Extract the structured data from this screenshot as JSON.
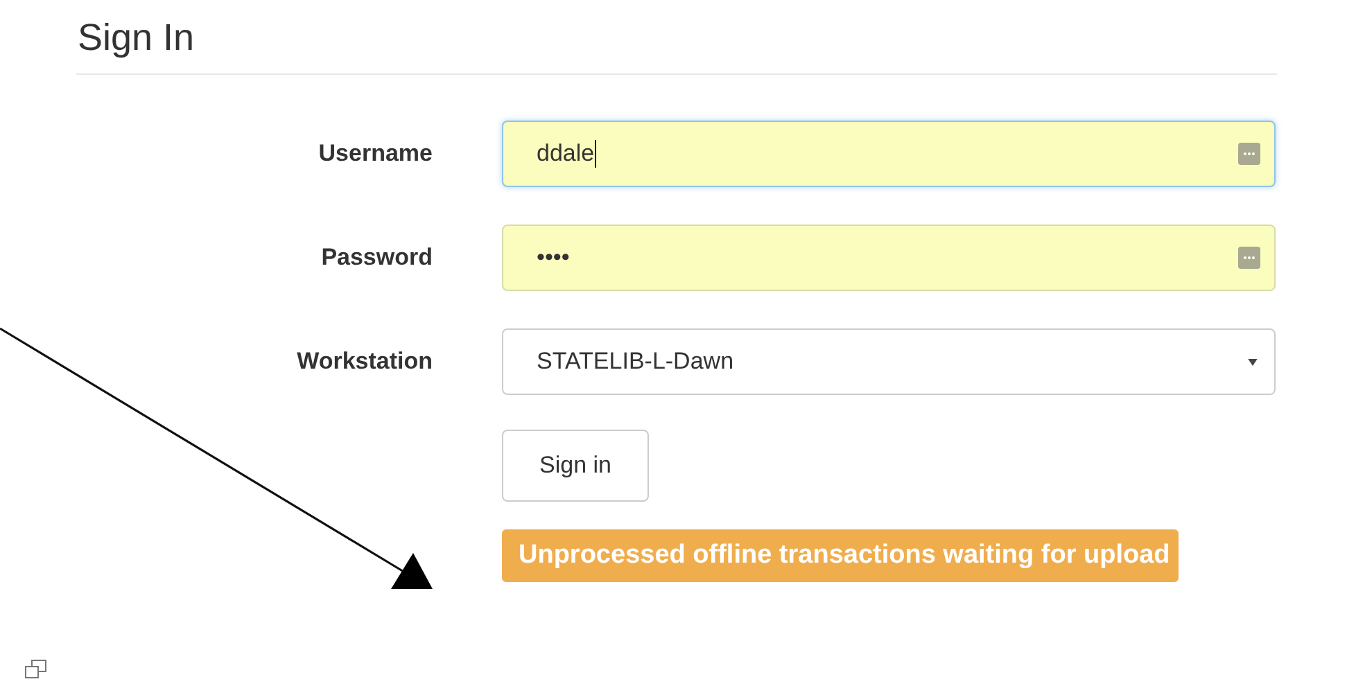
{
  "title": "Sign In",
  "fields": [
    {
      "kind": "text",
      "label": "Username",
      "value": "ddale",
      "focused": true,
      "autofill": true
    },
    {
      "kind": "text",
      "label": "Password",
      "value": "••••",
      "focused": false,
      "autofill": true
    },
    {
      "kind": "select",
      "label": "Workstation",
      "value": "STATELIB-L-Dawn",
      "focused": false,
      "autofill": false
    }
  ],
  "button": "Sign in",
  "alert": "Unprocessed offline transactions waiting for upload"
}
